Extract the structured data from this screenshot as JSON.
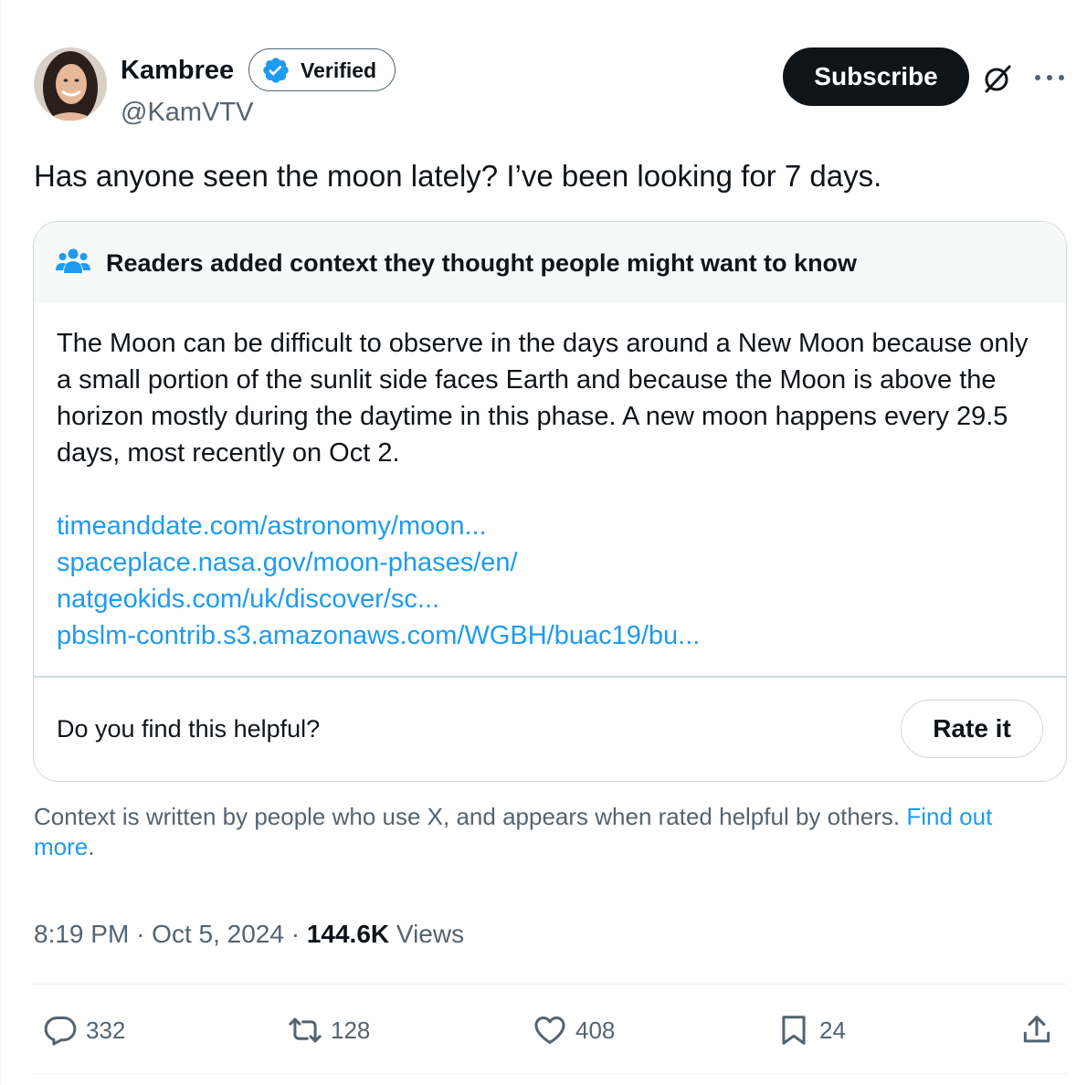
{
  "author": {
    "name": "Kambree",
    "verified_label": "Verified",
    "handle": "@KamVTV"
  },
  "header_actions": {
    "subscribe_label": "Subscribe",
    "grok_icon": "grok-icon",
    "more_icon": "more-icon"
  },
  "tweet": {
    "text": "Has anyone seen the moon lately? I’ve been looking for 7 days."
  },
  "community_note": {
    "header": "Readers added context they thought people might want to know",
    "body": "The Moon can be difficult to observe in the days around a New Moon because only a small portion of the sunlit side faces Earth and because the Moon is above the horizon mostly during the daytime in this phase. A new moon happens every 29.5 days, most recently on Oct 2.",
    "links": [
      "timeanddate.com/astronomy/moon...",
      "spaceplace.nasa.gov/moon-phases/en/",
      "natgeokids.com/uk/discover/sc...",
      "pbslm-contrib.s3.amazonaws.com/WGBH/buac19/bu..."
    ],
    "helpful_question": "Do you find this helpful?",
    "rate_label": "Rate it"
  },
  "context_disclaimer": {
    "text": "Context is written by people who use X, and appears when rated helpful by others. ",
    "link": "Find out more",
    "suffix": "."
  },
  "meta": {
    "time": "8:19 PM",
    "separator": "·",
    "date": "Oct 5, 2024",
    "views_count": "144.6K",
    "views_label": "Views"
  },
  "actions": {
    "replies": "332",
    "reposts": "128",
    "likes": "408",
    "bookmarks": "24"
  },
  "colors": {
    "accent_blue": "#1d9bf0",
    "text_primary": "#0f1419",
    "text_secondary": "#536471",
    "border": "#cfd9de"
  }
}
